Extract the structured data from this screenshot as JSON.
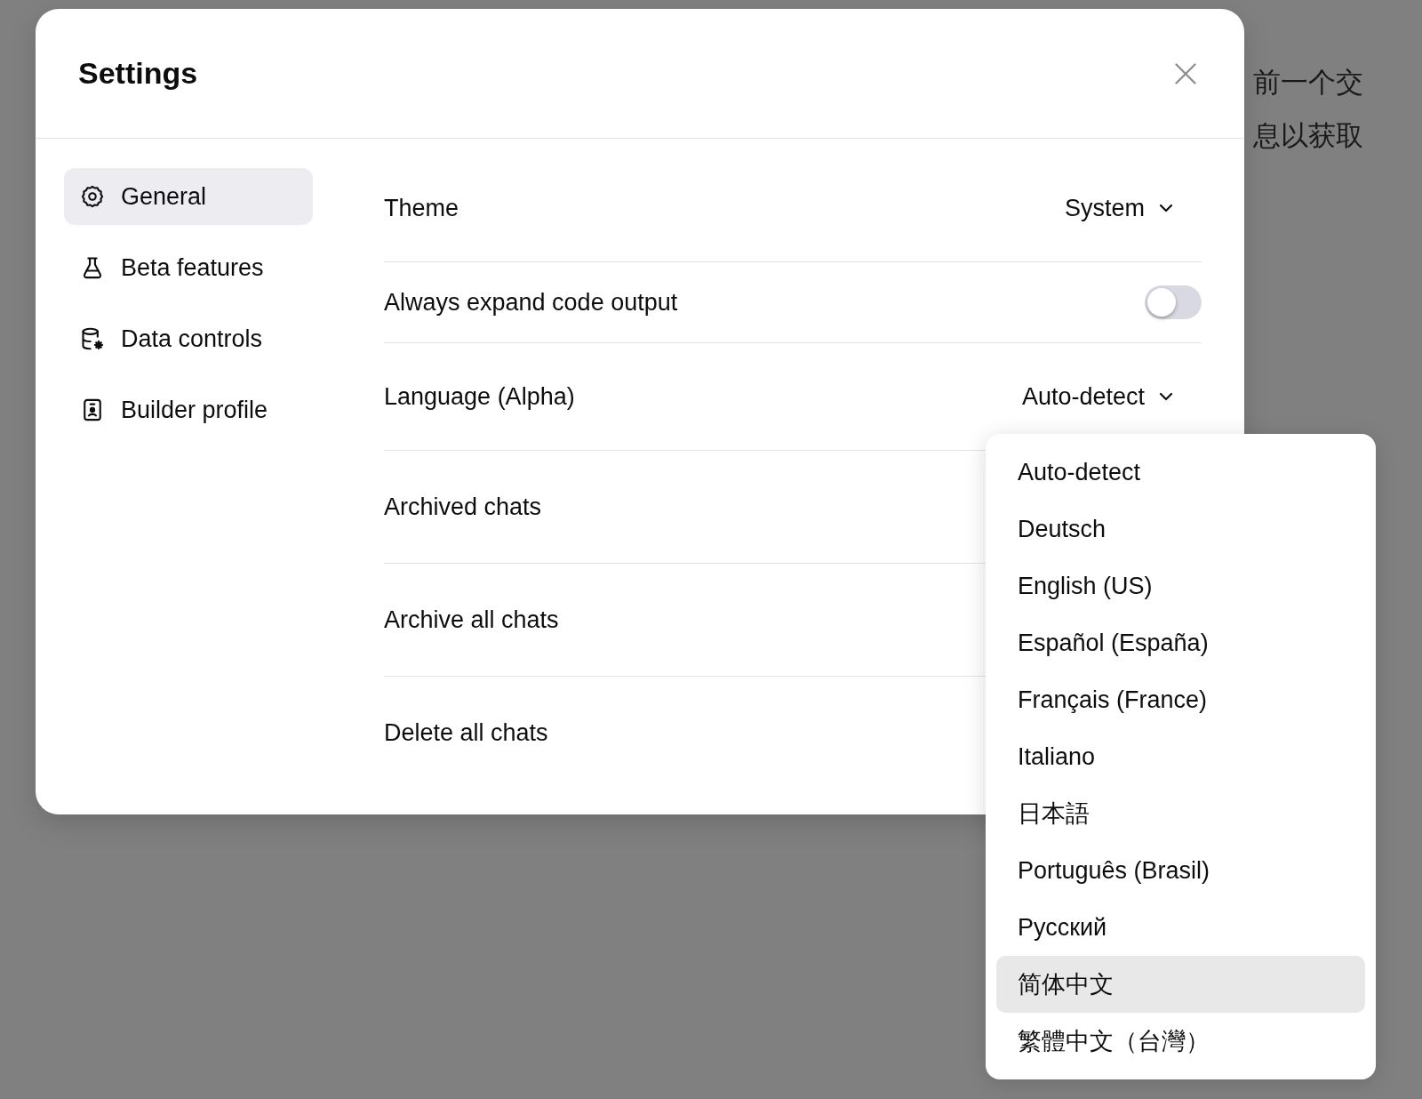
{
  "background": {
    "side_lines": [
      "前一个交",
      "息以获取"
    ]
  },
  "dialog": {
    "title": "Settings",
    "sidebar": {
      "items": [
        {
          "label": "General",
          "selected": true
        },
        {
          "label": "Beta features",
          "selected": false
        },
        {
          "label": "Data controls",
          "selected": false
        },
        {
          "label": "Builder profile",
          "selected": false
        }
      ]
    },
    "rows": [
      {
        "kind": "select",
        "label": "Theme",
        "value": "System"
      },
      {
        "kind": "toggle",
        "label": "Always expand code output",
        "on": false
      },
      {
        "kind": "select",
        "label": "Language (Alpha)",
        "value": "Auto-detect"
      },
      {
        "kind": "action",
        "label": "Archived chats"
      },
      {
        "kind": "action",
        "label": "Archive all chats"
      },
      {
        "kind": "action",
        "label": "Delete all chats"
      }
    ]
  },
  "language_menu": {
    "options": [
      {
        "label": "Auto-detect",
        "selected": false
      },
      {
        "label": "Deutsch",
        "selected": false
      },
      {
        "label": "English (US)",
        "selected": false
      },
      {
        "label": "Español (España)",
        "selected": false
      },
      {
        "label": "Français (France)",
        "selected": false
      },
      {
        "label": "Italiano",
        "selected": false
      },
      {
        "label": "日本語",
        "selected": false
      },
      {
        "label": "Português (Brasil)",
        "selected": false
      },
      {
        "label": "Русский",
        "selected": false
      },
      {
        "label": "简体中文",
        "selected": true
      },
      {
        "label": "繁體中文（台灣）",
        "selected": false
      }
    ]
  }
}
